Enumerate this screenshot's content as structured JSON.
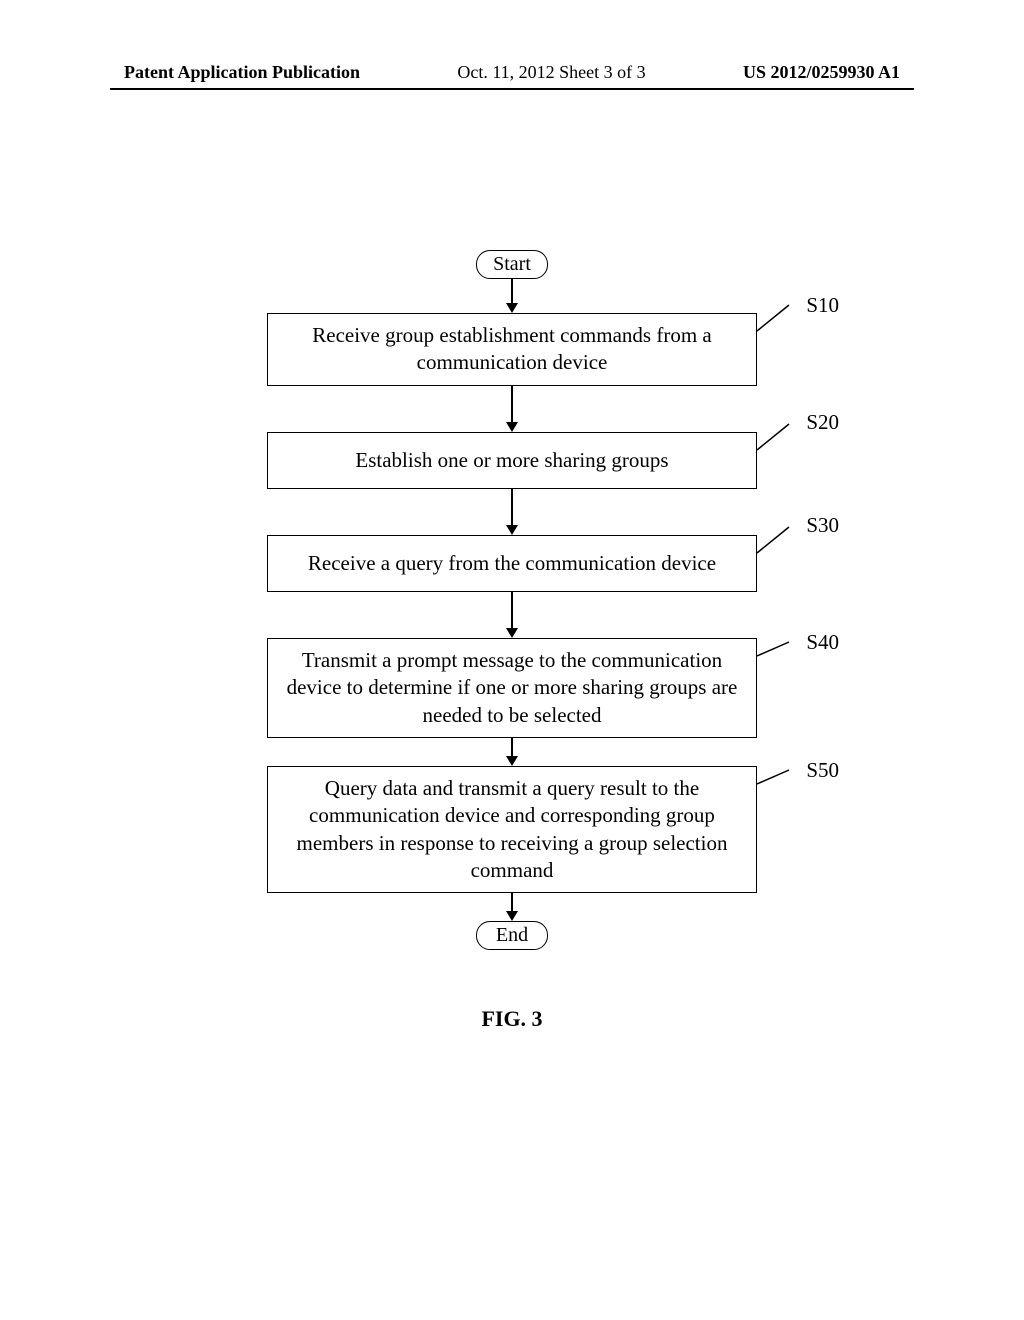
{
  "header": {
    "left": "Patent Application Publication",
    "middle": "Oct. 11, 2012  Sheet 3 of 3",
    "right": "US 2012/0259930 A1"
  },
  "flowchart": {
    "start_label": "Start",
    "end_label": "End",
    "steps": [
      {
        "id": "S10",
        "text": "Receive group establishment commands from a communication device"
      },
      {
        "id": "S20",
        "text": "Establish one or more sharing groups"
      },
      {
        "id": "S30",
        "text": "Receive a query from the communication device"
      },
      {
        "id": "S40",
        "text": "Transmit a prompt message to the communication device to determine if one or more sharing groups are needed to be selected"
      },
      {
        "id": "S50",
        "text": "Query data and transmit a query result to the communication device and corresponding group members in response to receiving a group selection command"
      }
    ]
  },
  "figure_caption": "FIG. 3"
}
